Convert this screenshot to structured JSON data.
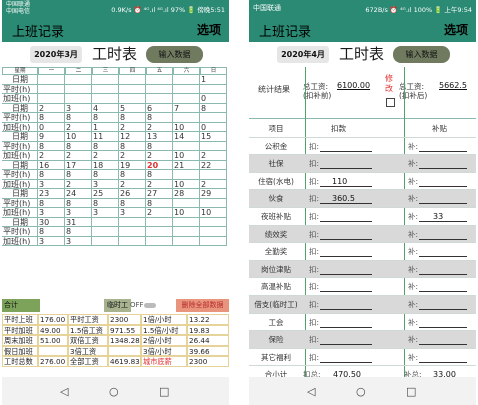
{
  "left": {
    "status": {
      "carrier1": "中国联通",
      "carrier2": "中国电信",
      "info": "0.9K/s ⏰ ⁴ᴳ.ıl ⁴ᴳ.ıl 97% 🔋 傍晚5:51"
    },
    "app": {
      "title": "上班记录",
      "menu": "选项"
    },
    "header": {
      "date_btn": "2020年3月",
      "big_title": "工时表",
      "input_btn": "输入数据"
    },
    "calendar": {
      "weekdays": [
        "星期",
        "一",
        "二",
        "三",
        "四",
        "五",
        "六",
        "日"
      ],
      "rows": [
        [
          "日期",
          "",
          "",
          "",
          "",
          "",
          "",
          "1"
        ],
        [
          "平时(h)",
          "",
          "",
          "",
          "",
          "",
          "",
          ""
        ],
        [
          "加班(h)",
          "",
          "",
          "",
          "",
          "",
          "",
          "0"
        ],
        [
          "日期",
          "2",
          "3",
          "4",
          "5",
          "6",
          "7",
          "8"
        ],
        [
          "平时(h)",
          "8",
          "8",
          "8",
          "8",
          "8",
          "",
          ""
        ],
        [
          "加班(h)",
          "0",
          "2",
          "1",
          "2",
          "2",
          "10",
          "0"
        ],
        [
          "日期",
          "9",
          "10",
          "11",
          "12",
          "13",
          "14",
          "15"
        ],
        [
          "平时(h)",
          "8",
          "8",
          "8",
          "8",
          "8",
          "",
          ""
        ],
        [
          "加班(h)",
          "2",
          "2",
          "2",
          "2",
          "2",
          "10",
          "2"
        ],
        [
          "日期",
          "16",
          "17",
          "18",
          "19",
          "20",
          "21",
          "22"
        ],
        [
          "平时(h)",
          "8",
          "8",
          "8",
          "8",
          "8",
          "",
          ""
        ],
        [
          "加班(h)",
          "3",
          "2",
          "3",
          "2",
          "2",
          "10",
          "2"
        ],
        [
          "日期",
          "23",
          "24",
          "25",
          "26",
          "27",
          "28",
          "29"
        ],
        [
          "平时(h)",
          "8",
          "8",
          "8",
          "8",
          "8",
          "",
          ""
        ],
        [
          "加班(h)",
          "3",
          "3",
          "3",
          "3",
          "2",
          "10",
          "10"
        ],
        [
          "日期",
          "30",
          "31",
          "",
          "",
          "",
          "",
          ""
        ],
        [
          "平时(h)",
          "8",
          "8",
          "",
          "",
          "",
          "",
          ""
        ],
        [
          "加班(h)",
          "3",
          "3",
          "",
          "",
          "",
          "",
          ""
        ]
      ],
      "highlight": "20"
    },
    "summary_bar": {
      "total": "合计",
      "temp_label": "临时工",
      "toggle": "OFF",
      "clear": "删除全部数据"
    },
    "summary": [
      [
        "平时上班",
        "176.00",
        "平时工资",
        "2300",
        "1倍/小时",
        "13.22"
      ],
      [
        "平时加班",
        "49.00",
        "1.5倍工资",
        "971.55",
        "1.5倍/小时",
        "19.83"
      ],
      [
        "周末加班",
        "51.00",
        "双倍工资",
        "1348.28",
        "2倍/小时",
        "26.44"
      ],
      [
        "假日加班",
        "",
        "3倍工资",
        "",
        "3倍/小时",
        "39.66"
      ],
      [
        "工时总数",
        "276.00",
        "全部工资",
        "4619.83",
        "城市底薪",
        "2300"
      ]
    ]
  },
  "right": {
    "status": {
      "carrier": "中国联通",
      "info": "672B/s ⏰ ⁴ᴳ.ıl 100% 🔋 上午9:54"
    },
    "app": {
      "title": "上班记录",
      "menu": "选项"
    },
    "header": {
      "date_btn": "2020年4月",
      "big_title": "工时表",
      "input_btn": "输入数据"
    },
    "stats": {
      "label": "统计结果",
      "total1": "总工资:\n(扣补前)",
      "value1": "6100.00",
      "edit": "修改",
      "total2": "总工资:\n(扣补后)",
      "value2": "5662.5"
    },
    "col_headers": {
      "item": "项目",
      "deduct": "扣款",
      "subsidy": "补贴"
    },
    "ded_prefix": "扣:",
    "sub_prefix": "补:",
    "items": [
      {
        "name": "公积金",
        "ded": "",
        "sub": ""
      },
      {
        "name": "社保",
        "ded": "",
        "sub": ""
      },
      {
        "name": "住宿(水电)",
        "ded": "110",
        "sub": ""
      },
      {
        "name": "伙食",
        "ded": "360.5",
        "sub": ""
      },
      {
        "name": "夜班补贴",
        "ded": "",
        "sub": "33"
      },
      {
        "name": "绩效奖",
        "ded": "",
        "sub": ""
      },
      {
        "name": "全勤奖",
        "ded": "",
        "sub": ""
      },
      {
        "name": "岗位津贴",
        "ded": "",
        "sub": ""
      },
      {
        "name": "高温补贴",
        "ded": "",
        "sub": ""
      },
      {
        "name": "借支(临时工)",
        "ded": "",
        "sub": ""
      },
      {
        "name": "工会",
        "ded": "",
        "sub": ""
      },
      {
        "name": "保险",
        "ded": "",
        "sub": ""
      },
      {
        "name": "其它福利",
        "ded": "",
        "sub": ""
      }
    ],
    "total_row": {
      "name": "合小计",
      "ded_label": "扣总:",
      "ded": "470.50",
      "sub_label": "补总:",
      "sub": "33.00"
    }
  },
  "nav": {
    "back": "◁",
    "home": "○",
    "recent": "□"
  }
}
